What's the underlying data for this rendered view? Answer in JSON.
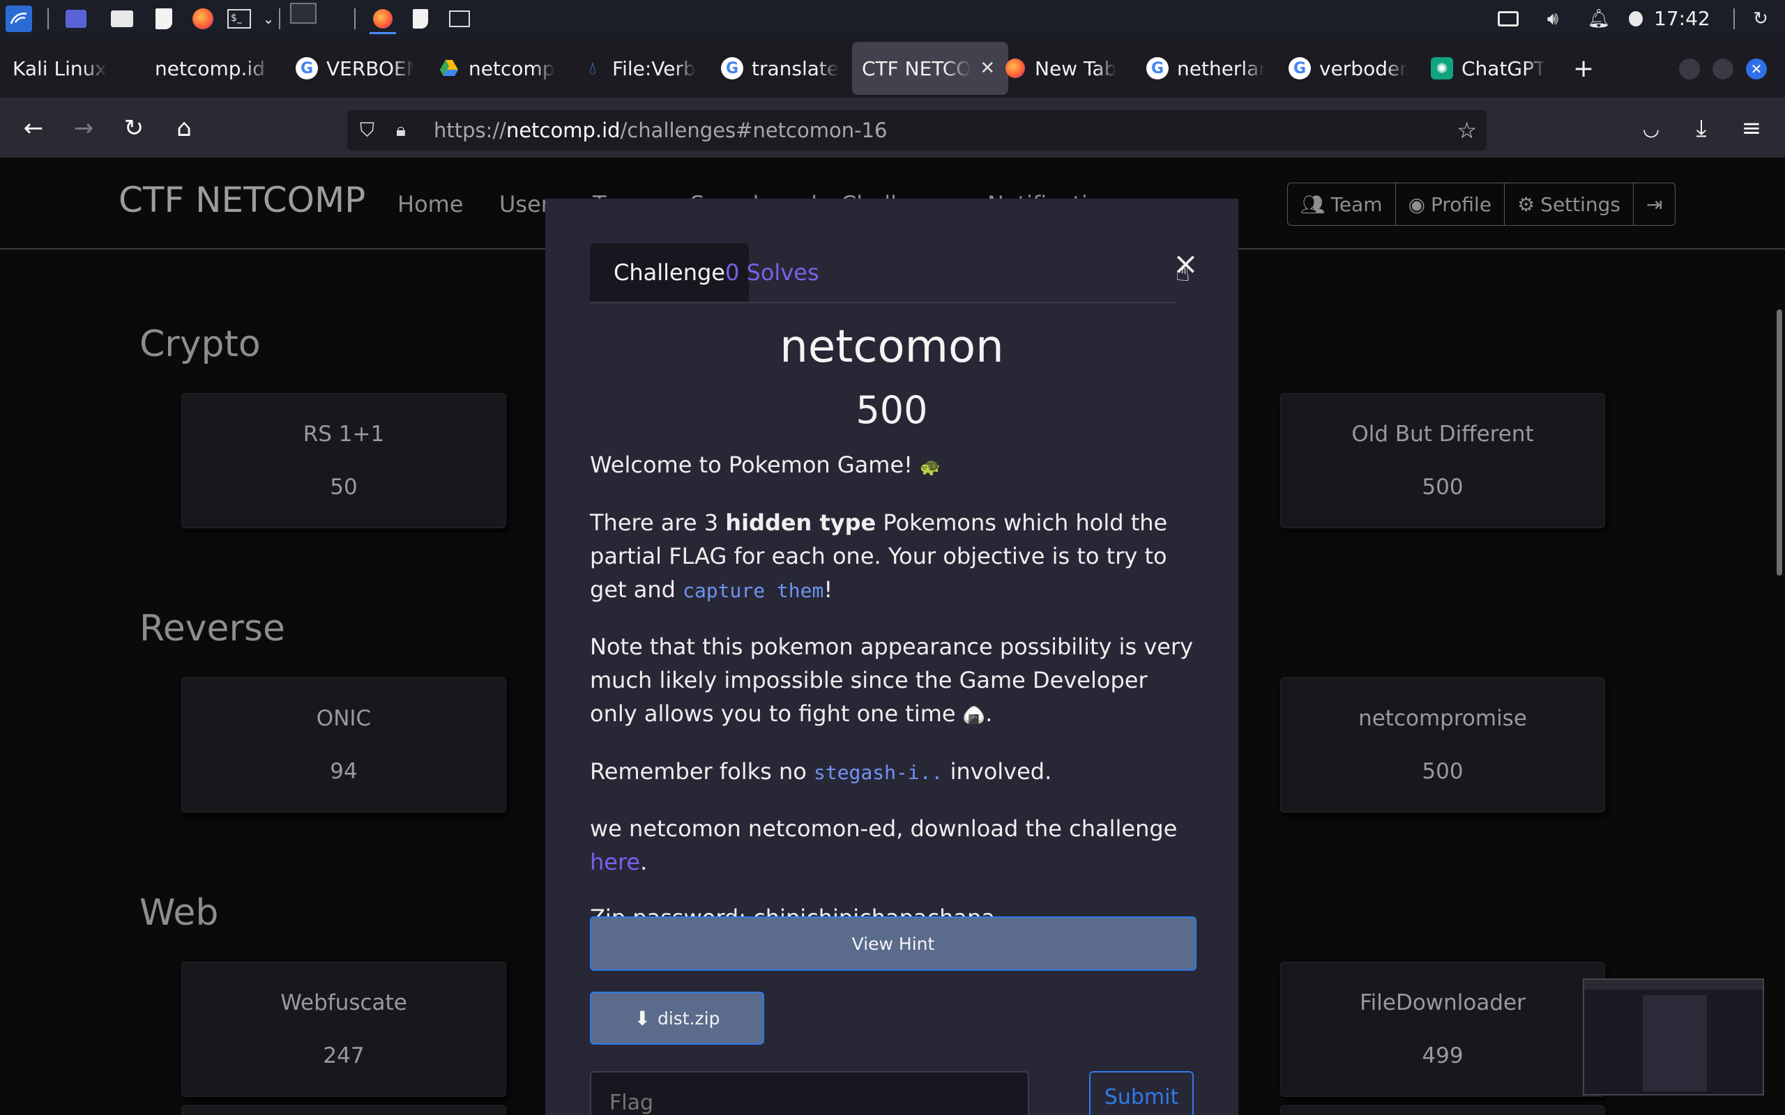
{
  "taskbar": {
    "clock": "17:42",
    "icons": [
      "kali-menu-icon",
      "workspace-icon",
      "file-manager-icon",
      "text-editor-icon",
      "firefox-icon",
      "terminal-icon",
      "chevron-down-icon",
      "window-preview-icon",
      "firefox-running-icon",
      "editor-running-icon",
      "terminal-running-icon",
      "network-icon",
      "volume-icon",
      "notification-bell-icon",
      "power-manager-icon",
      "session-icon"
    ]
  },
  "browser": {
    "tabs": [
      {
        "label": "Kali Linux",
        "icon": "kali-icon"
      },
      {
        "label": "netcomp.id |",
        "icon": "none"
      },
      {
        "label": "VERBOEN",
        "icon": "google-icon"
      },
      {
        "label": "netcomp",
        "icon": "drive-icon"
      },
      {
        "label": "File:Verb",
        "icon": "wiki-icon"
      },
      {
        "label": "translate",
        "icon": "google-icon"
      },
      {
        "label": "CTF NETCO",
        "icon": "none",
        "active": true
      },
      {
        "label": "New Tab",
        "icon": "firefox-icon"
      },
      {
        "label": "netherlan",
        "icon": "google-icon"
      },
      {
        "label": "verboden",
        "icon": "google-icon"
      },
      {
        "label": "ChatGPT",
        "icon": "chatgpt-icon"
      }
    ],
    "new_tab_symbol": "+",
    "url_prefix": "https://",
    "url_host": "netcomp.id",
    "url_path": "/challenges#netcomon-16"
  },
  "site": {
    "brand": "CTF NETCOMP",
    "nav": [
      "Home",
      "Users",
      "Teams",
      "Scoreboard",
      "Challenges",
      "Notifications"
    ],
    "user_buttons": [
      {
        "label": "Team",
        "icon": "users-icon"
      },
      {
        "label": "Profile",
        "icon": "user-circle-icon"
      },
      {
        "label": "Settings",
        "icon": "cogs-icon"
      },
      {
        "label": "",
        "icon": "logout-icon"
      }
    ],
    "categories": [
      {
        "name": "Crypto",
        "cards": [
          {
            "name": "RS 1+1",
            "points": "50"
          },
          {
            "name": "Old But Different",
            "points": "500"
          }
        ]
      },
      {
        "name": "Reverse",
        "cards": [
          {
            "name": "ONIC",
            "points": "94"
          },
          {
            "name": "netcompromise",
            "points": "500"
          }
        ]
      },
      {
        "name": "Web",
        "cards": [
          {
            "name": "Webfuscate",
            "points": "247"
          },
          {
            "name": "FileDownloader",
            "points": "499"
          }
        ]
      }
    ]
  },
  "modal": {
    "tab_challenge": "Challenge",
    "tab_solves": "0 Solves",
    "close_symbol": "×",
    "name": "netcomon",
    "value": "500",
    "desc": {
      "p1": "Welcome to Pokemon Game!",
      "p1_emoji": "🐢",
      "p2_a": "There are 3",
      "p2_bold": "hidden type",
      "p2_b": "Pokemons which hold the partial FLAG for each one. Your objective is to try to get and",
      "p2_code": "capture them",
      "p2_c": "!",
      "p3_a": "Note that this pokemon appearance possibility is very much likely impossible since the Game Developer only allows you to fight one time",
      "p3_emoji": "🍙",
      "p3_b": ".",
      "p4_a": "Remember folks no",
      "p4_code": "stegash-i..",
      "p4_b": "involved.",
      "p5_a": "we netcomon netcomon-ed, download the challenge",
      "p5_link": "here",
      "p5_b": ".",
      "p6": "Zip password: chipichipichapachapa"
    },
    "hint_button": "View Hint",
    "file_button": "dist.zip",
    "flag_placeholder": "Flag",
    "submit_button": "Submit"
  }
}
